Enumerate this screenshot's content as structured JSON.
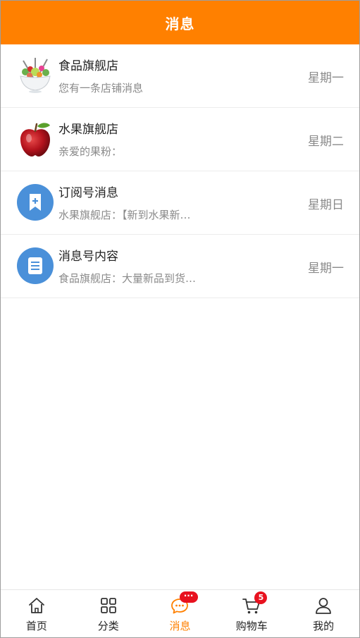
{
  "header": {
    "title": "消息"
  },
  "messages": [
    {
      "avatar": "salad-bowl-image",
      "title": "食品旗舰店",
      "preview": "您有一条店铺消息",
      "time": "星期一"
    },
    {
      "avatar": "red-apple-image",
      "title": "水果旗舰店",
      "preview": "亲爱的果粉：",
      "time": "星期二"
    },
    {
      "avatar": "bookmark-plus-icon",
      "title": "订阅号消息",
      "preview": "水果旗舰店：【新到水果新…",
      "time": "星期日"
    },
    {
      "avatar": "document-icon",
      "title": "消息号内容",
      "preview": "食品旗舰店：大量新品到货…",
      "time": "星期一"
    }
  ],
  "tabbar": {
    "items": [
      {
        "label": "首页",
        "icon": "home-icon",
        "active": false
      },
      {
        "label": "分类",
        "icon": "grid-icon",
        "active": false
      },
      {
        "label": "消息",
        "icon": "chat-icon",
        "active": true,
        "badge": "···"
      },
      {
        "label": "购物车",
        "icon": "cart-icon",
        "active": false,
        "badge": "5"
      },
      {
        "label": "我的",
        "icon": "user-icon",
        "active": false
      }
    ]
  },
  "colors": {
    "accent": "#ff8000",
    "badge": "#e8121f",
    "icon_blue": "#4a90d9"
  }
}
